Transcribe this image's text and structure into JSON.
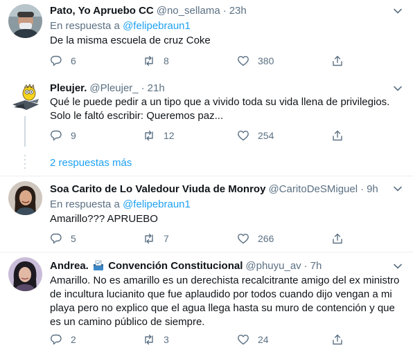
{
  "tweets": [
    {
      "display_name": "Pato, Yo Apruebo CC",
      "handle": "@no_sellama",
      "time": "23h",
      "reply_prefix": "En respuesta a ",
      "reply_link": "@felipebraun1",
      "lines": [
        "De la misma escuela de cruz Coke"
      ],
      "replies": "6",
      "retweets": "8",
      "likes": "380",
      "avatar_icon": "user-avatar-man-with-mask"
    },
    {
      "display_name": "Pleujer.",
      "handle": "@Pleujer_",
      "time": "21h",
      "lines": [
        "Qué le puede pedir a un tipo que a vivido toda su vida llena de privilegios.",
        "Solo le faltó escribir: Queremos paz..."
      ],
      "replies": "9",
      "retweets": "12",
      "likes": "254",
      "avatar_icon": "user-avatar-cartoon"
    },
    {
      "display_name": "Soa Carito de Lo Valedour Viuda de Monroy",
      "handle": "@CaritoDeSMiguel",
      "time": "9h",
      "reply_prefix": "En respuesta a ",
      "reply_link": "@felipebraun1",
      "lines": [
        "Amarillo??? APRUEBO"
      ],
      "replies": "5",
      "retweets": "7",
      "likes": "266",
      "avatar_icon": "user-avatar-woman"
    },
    {
      "display_name": "Andrea.",
      "display_name_suffix": "Convención Constitucional",
      "handle": "@phuyu_av",
      "time": "7h",
      "lines": [
        "Amarillo. No es amarillo es un derechista recalcitrante  amigo del ex ministro",
        "de incultura lucianito  que fue aplaudido por todos cuando dijo vengan a mi",
        "playa pero no explico que el agua llega hasta su muro de contención y que",
        "es un camino público de siempre."
      ],
      "replies": "2",
      "retweets": "3",
      "likes": "24",
      "avatar_icon": "user-avatar-woman-dark-hair"
    }
  ],
  "thread": {
    "more_replies": "2 respuestas más"
  },
  "colors": {
    "link": "#1da1f2",
    "secondary": "#5b7083",
    "separator": "#ebeef0"
  }
}
